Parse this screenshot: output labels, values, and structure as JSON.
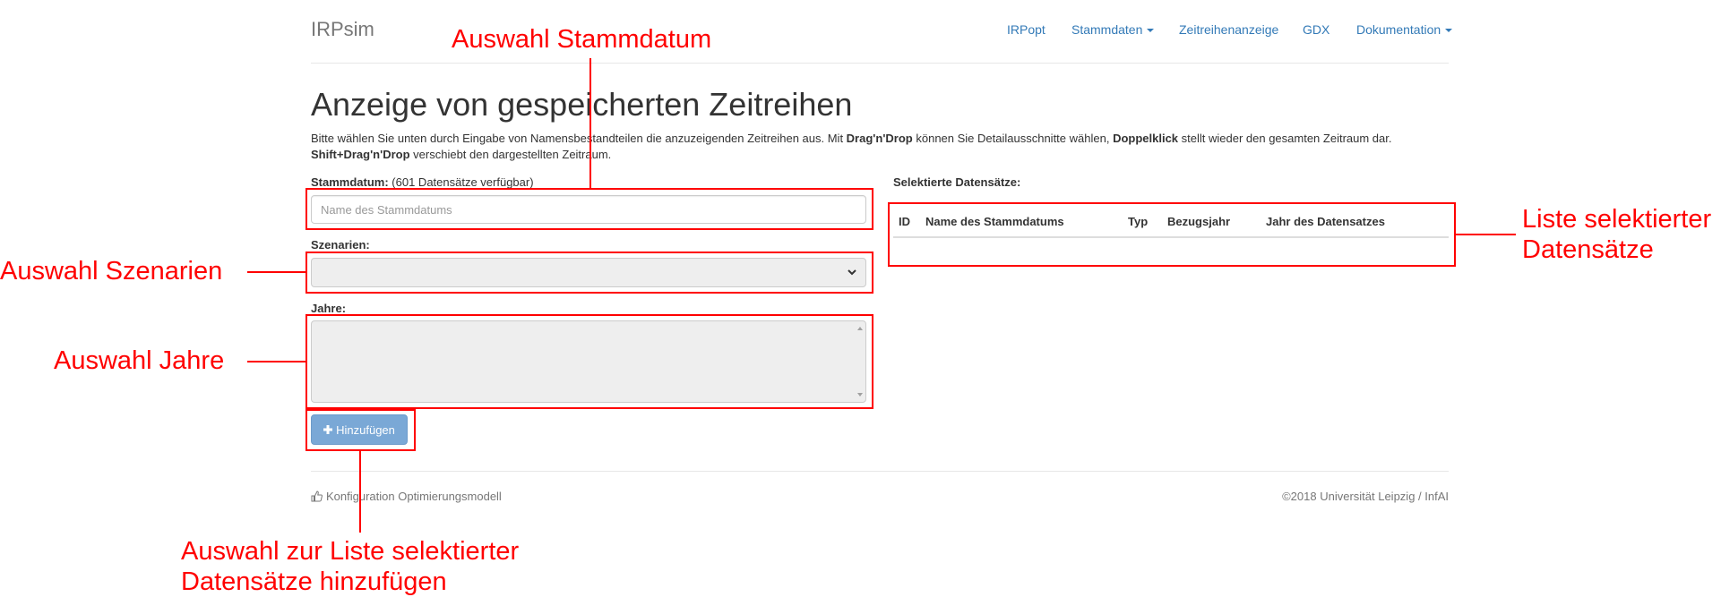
{
  "navbar": {
    "brand": "IRPsim",
    "items": [
      {
        "label": "IRPopt",
        "dropdown": false
      },
      {
        "label": "Stammdaten",
        "dropdown": true
      },
      {
        "label": "Zeitreihenanzeige",
        "dropdown": false
      },
      {
        "label": "GDX",
        "dropdown": false
      },
      {
        "label": "Dokumentation",
        "dropdown": true
      }
    ]
  },
  "page": {
    "title": "Anzeige von gespeicherten Zeitreihen",
    "intro": {
      "p1": "Bitte wählen Sie unten durch Eingabe von Namensbestandteilen die anzuzeigenden Zeitreihen aus. Mit ",
      "b1": "Drag'n'Drop",
      "p2": " können Sie Detailausschnitte wählen, ",
      "b2": "Doppelklick",
      "p3": " stellt wieder den gesamten Zeitraum dar. ",
      "b3": "Shift+Drag'n'Drop",
      "p4": " verschiebt den dargestellten Zeitraum."
    }
  },
  "form": {
    "stammdatum_label": "Stammdatum:",
    "stammdatum_count": " (601 Datensätze verfügbar)",
    "stammdatum_placeholder": "Name des Stammdatums",
    "stammdatum_value": "",
    "szenarien_label": "Szenarien:",
    "szenarien_value": "",
    "jahre_label": "Jahre:",
    "add_button": "Hinzufügen"
  },
  "selected": {
    "title": "Selektierte Datensätze:",
    "columns": [
      "ID",
      "Name des Stammdatums",
      "Typ",
      "Bezugsjahr",
      "Jahr des Datensatzes"
    ],
    "rows": []
  },
  "footer": {
    "left": "Konfiguration Optimierungsmodell",
    "right": "©2018 Universität Leipzig / InfAI"
  },
  "annotations": {
    "stammdatum": "Auswahl Stammdatum",
    "szenarien": "Auswahl Szenarien",
    "jahre": "Auswahl Jahre",
    "liste_line1": "Liste selektierter",
    "liste_line2": "Datensätze",
    "hinzu_line1": "Auswahl zur Liste selektierter",
    "hinzu_line2": "Datensätze hinzufügen"
  },
  "colors": {
    "annotation": "#ff0000",
    "link": "#337ab7",
    "button": "#7aa8d6"
  },
  "icons": {
    "add_button_icon": "plus-icon",
    "footer_icon": "thumbs-up-icon"
  }
}
